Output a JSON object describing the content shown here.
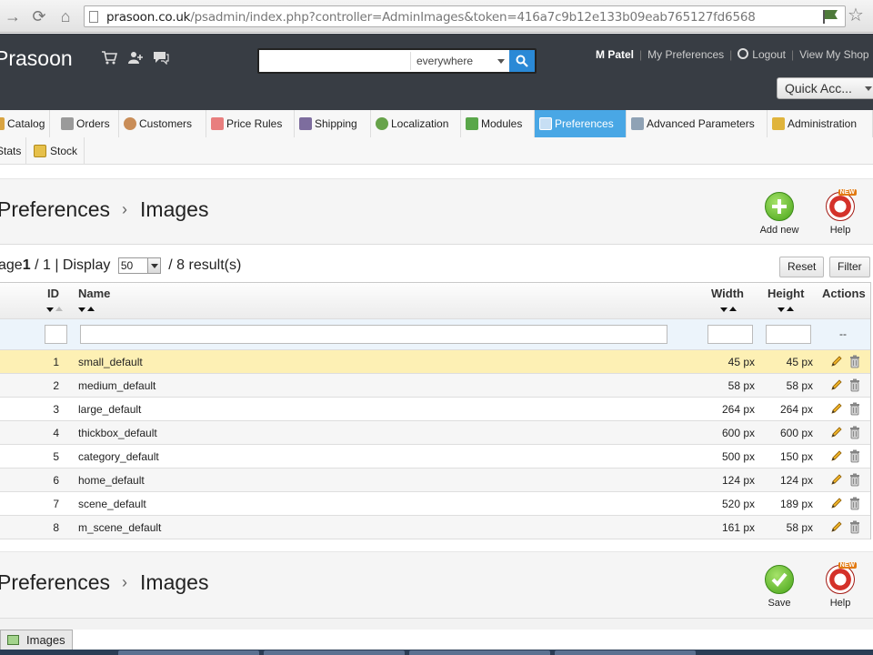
{
  "browser": {
    "url_host": "prasoon.co.uk",
    "url_path": "/psadmin/index.php?controller=AdminImages&token=416a7c9b12e133b09eab765127fd6568"
  },
  "header": {
    "shop_name": "Prasoon",
    "search": {
      "value": "",
      "scope": "everywhere"
    },
    "user_name": "M Patel",
    "my_preferences": "My Preferences",
    "logout": "Logout",
    "view_my_shop": "View My Shop",
    "quick_access": "Quick Acc..."
  },
  "menu": {
    "tabs": [
      {
        "label": "Catalog",
        "icon": "catalog-icon"
      },
      {
        "label": "Orders",
        "icon": "cart-icon"
      },
      {
        "label": "Customers",
        "icon": "customer-icon"
      },
      {
        "label": "Price Rules",
        "icon": "price-rules-icon"
      },
      {
        "label": "Shipping",
        "icon": "truck-icon"
      },
      {
        "label": "Localization",
        "icon": "globe-icon"
      },
      {
        "label": "Modules",
        "icon": "puzzle-icon"
      },
      {
        "label": "Preferences",
        "icon": "preferences-icon",
        "active": true
      },
      {
        "label": "Advanced Parameters",
        "icon": "wrench-icon"
      },
      {
        "label": "Administration",
        "icon": "key-icon"
      },
      {
        "label": "Stats",
        "icon": "stats-icon"
      },
      {
        "label": "Stock",
        "icon": "stock-icon"
      }
    ]
  },
  "page": {
    "breadcrumb_parent": "Preferences",
    "breadcrumb_current": "Images",
    "add_new": "Add new",
    "help": "Help",
    "new_tag": "NEW",
    "save": "Save"
  },
  "pagination": {
    "prefix": "age",
    "current_page": "1",
    "total_pages": "/ 1",
    "display_label": "| Display",
    "per_page": "50",
    "results": "/ 8 result(s)",
    "reset": "Reset",
    "filter": "Filter"
  },
  "table": {
    "headers": {
      "id": "ID",
      "name": "Name",
      "width": "Width",
      "height": "Height",
      "actions": "Actions"
    },
    "filter_placeholder": "--",
    "rows": [
      {
        "id": "1",
        "name": "small_default",
        "width": "45 px",
        "height": "45 px"
      },
      {
        "id": "2",
        "name": "medium_default",
        "width": "58 px",
        "height": "58 px"
      },
      {
        "id": "3",
        "name": "large_default",
        "width": "264 px",
        "height": "264 px"
      },
      {
        "id": "4",
        "name": "thickbox_default",
        "width": "600 px",
        "height": "600 px"
      },
      {
        "id": "5",
        "name": "category_default",
        "width": "500 px",
        "height": "150 px"
      },
      {
        "id": "6",
        "name": "home_default",
        "width": "124 px",
        "height": "124 px"
      },
      {
        "id": "7",
        "name": "scene_default",
        "width": "520 px",
        "height": "189 px"
      },
      {
        "id": "8",
        "name": "m_scene_default",
        "width": "161 px",
        "height": "58 px"
      }
    ]
  },
  "bottom_tab": "Images",
  "colors": {
    "active_tab": "#49a7e5",
    "header_bg": "#383d44",
    "highlight_row": "#fdf0b4",
    "search_button": "#2a89d6"
  }
}
